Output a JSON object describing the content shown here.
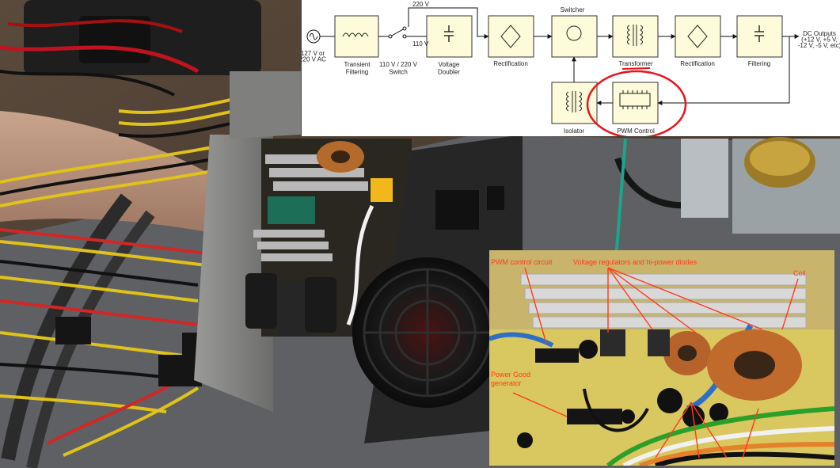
{
  "diagram": {
    "source_label": "127 V or\n220 V AC",
    "blocks": {
      "transient": "Transient\nFiltering",
      "switch": "110 V / 220 V\nSwitch",
      "doubler": "Voltage\nDoubler",
      "rect1": "Rectification",
      "switcher": "Switcher",
      "transformer": "Transformer",
      "rect2": "Rectification",
      "filtering": "Filtering",
      "isolator": "Isolator",
      "pwm": "PWM Control"
    },
    "wire_labels": {
      "v220": "220 V",
      "v110": "110 V"
    },
    "outputs": "DC Outputs\n(+12 V, +5 V,\n-12 V, -5 V, etc)"
  },
  "inset": {
    "labels": {
      "pwm_circuit": "PWM control circuit",
      "regulators": "Voltage regulators and hi-power diodes",
      "coil": "Coil",
      "power_good": "Power Good\ngenerator"
    }
  },
  "colors": {
    "highlight": "#e8141a",
    "pointer": "#1aa58c",
    "label": "#ff3b1e",
    "block_fill": "#fdfbd9",
    "pcb": "#d9c760"
  }
}
